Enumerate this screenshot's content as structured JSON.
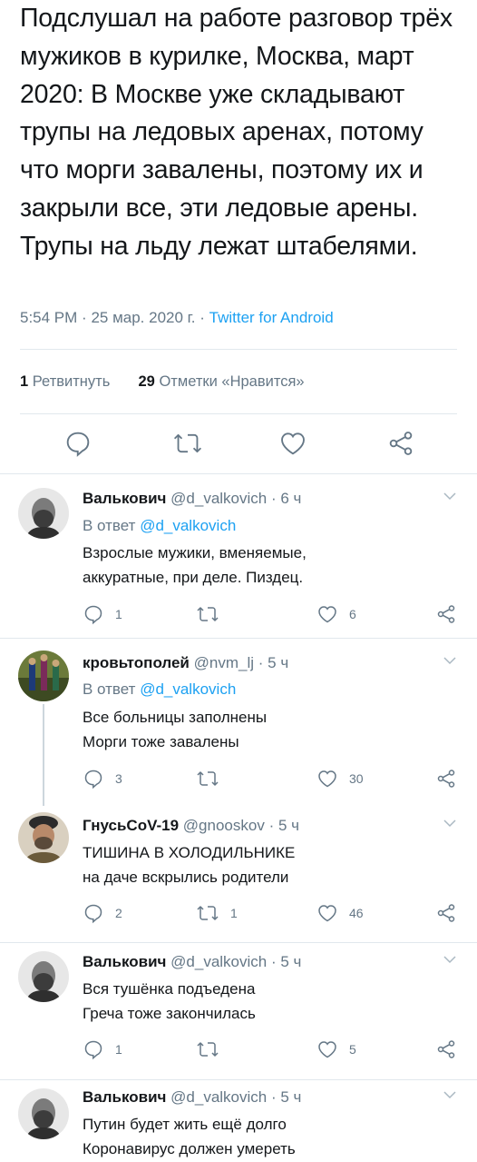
{
  "tweet": {
    "text": "Подслушал на работе разговор трёх мужиков в курилке, Москва, март 2020: В Москве уже складывают трупы на ледовых аренах, потому что морги завалены, поэтому их и закрыли все, эти ледовые арены. Трупы на льду лежат штабелями.",
    "time": "5:54 PM",
    "date": "25 мар. 2020 г.",
    "app": "Twitter for Android",
    "retweets_count": "1",
    "retweets_label": "Ретвитнуть",
    "likes_count": "29",
    "likes_label": "Отметки «Нравится»"
  },
  "replies": [
    {
      "name": "Валькович",
      "handle": "@d_valkovich",
      "time": "6 ч",
      "reply_to_prefix": "В ответ",
      "reply_to": "@d_valkovich",
      "text": "Взрослые мужики, вменяемые,\nаккуратные, при деле. Пиздец.",
      "reply_count": "1",
      "retweet_count": "",
      "like_count": "6"
    },
    {
      "name": "кровьтополей",
      "handle": "@nvm_lj",
      "time": "5 ч",
      "reply_to_prefix": "В ответ",
      "reply_to": "@d_valkovich",
      "text": "Все больницы заполнены\nМорги тоже завалены",
      "reply_count": "3",
      "retweet_count": "",
      "like_count": "30"
    },
    {
      "name": "ГнусьCoV-19",
      "handle": "@gnooskov",
      "time": "5 ч",
      "text": "ТИШИНА В ХОЛОДИЛЬНИКЕ\nна даче вскрылись родители",
      "reply_count": "2",
      "retweet_count": "1",
      "like_count": "46"
    },
    {
      "name": "Валькович",
      "handle": "@d_valkovich",
      "time": "5 ч",
      "text": "Вся тушёнка подъедена\nГреча тоже закончилась",
      "reply_count": "1",
      "retweet_count": "",
      "like_count": "5"
    },
    {
      "name": "Валькович",
      "handle": "@d_valkovich",
      "time": "5 ч",
      "text": "Путин будет жить ещё долго\nКоронавирус должен умереть"
    }
  ],
  "icons": {
    "reply": "reply-icon",
    "retweet": "retweet-icon",
    "like": "heart-icon",
    "share": "share-icon",
    "more": "chevron-down-icon"
  },
  "colors": {
    "text": "#14171a",
    "secondary": "#657786",
    "link": "#1da1f2",
    "divider": "#e1e8ed",
    "thread": "#cdd6dd"
  }
}
